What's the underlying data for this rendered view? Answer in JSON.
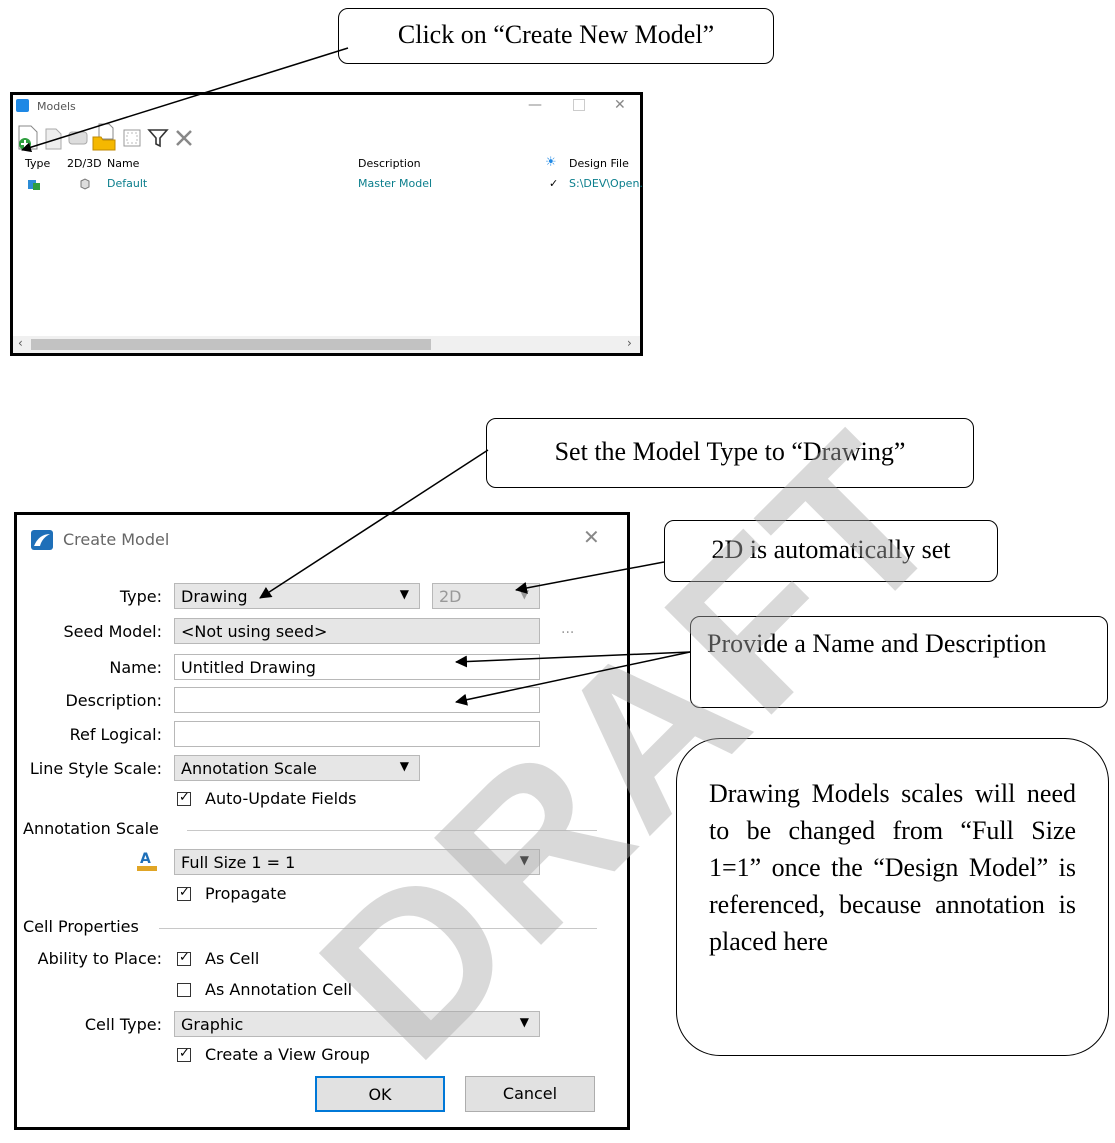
{
  "callouts": {
    "create_new_model": "Click on “Create New Model”",
    "model_type": "Set the Model Type to “Drawing”",
    "auto_2d": "2D is automatically set",
    "name_desc": "Provide a Name and Description",
    "scales_note": "Drawing Models scales will need to be changed from “Full Size 1=1” once the “Design Model” is referenced, because annotation is placed here"
  },
  "models_window": {
    "title": "Models",
    "columns": [
      "Type",
      "2D/3D",
      "Name",
      "Description",
      "Design File"
    ],
    "rows": [
      {
        "name": "Default",
        "description": "Master Model",
        "active_mark": "✓",
        "design_file": "S:\\DEV\\Open."
      }
    ]
  },
  "create_model": {
    "title": "Create Model",
    "type_label": "Type:",
    "type_value": "Drawing",
    "dim_value": "2D",
    "seed_label": "Seed Model:",
    "seed_value": "<Not using seed>",
    "seed_browse": "...",
    "name_label": "Name:",
    "name_value": "Untitled Drawing",
    "description_label": "Description:",
    "description_value": "",
    "ref_logical_label": "Ref Logical:",
    "ref_logical_value": "",
    "line_style_label": "Line Style Scale:",
    "line_style_value": "Annotation Scale",
    "auto_update_label": "Auto-Update Fields",
    "annotation_section": "Annotation Scale",
    "annotation_value": "Full Size 1 = 1",
    "propagate_label": "Propagate",
    "cell_section": "Cell Properties",
    "ability_label": "Ability to Place:",
    "as_cell_label": "As Cell",
    "as_annotation_cell_label": "As Annotation Cell",
    "cell_type_label": "Cell Type:",
    "cell_type_value": "Graphic",
    "view_group_label": "Create a View Group",
    "ok_label": "OK",
    "cancel_label": "Cancel",
    "checks": {
      "auto_update": true,
      "propagate": true,
      "as_cell": true,
      "as_annotation_cell": false,
      "view_group": true
    }
  },
  "watermark": "DRAFT",
  "colors": {
    "link_teal": "#0a7e8c",
    "accent_blue": "#1e88e5",
    "ok_border": "#0078d7"
  }
}
